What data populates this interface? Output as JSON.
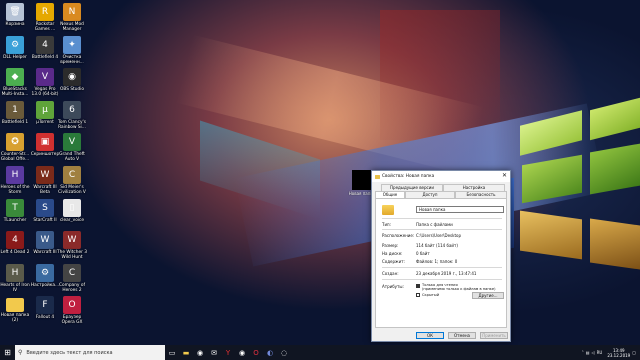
{
  "desktop_icons": [
    {
      "label": "Корзина",
      "icon": "recycle-bin-icon",
      "color": "#b6c3d6",
      "glyph": "🗑"
    },
    {
      "label": "Rockstar Games ...",
      "icon": "rockstar-icon",
      "color": "#e5a800",
      "glyph": "R"
    },
    {
      "label": "Nexus Mod Manager",
      "icon": "nexus-icon",
      "color": "#d98a20",
      "glyph": "N"
    },
    {
      "label": "DLL Helper",
      "icon": "dll-helper-icon",
      "color": "#3aa0d8",
      "glyph": "⚙"
    },
    {
      "label": "Battlefield 4",
      "icon": "battlefield-icon",
      "color": "#3a3a3a",
      "glyph": "4"
    },
    {
      "label": "Очистка временн...",
      "icon": "cleanup-icon",
      "color": "#5a8fcf",
      "glyph": "✦"
    },
    {
      "label": "BlueStacks Multi-Insta...",
      "icon": "bluestacks-icon",
      "color": "#4caf50",
      "glyph": "◆"
    },
    {
      "label": "Vegas Pro 13.0 (64-bit)",
      "icon": "vegas-icon",
      "color": "#5a2a8a",
      "glyph": "V"
    },
    {
      "label": "OBS Studio",
      "icon": "obs-icon",
      "color": "#2b2b2b",
      "glyph": "◉"
    },
    {
      "label": "Battlefield 1",
      "icon": "battlefield1-icon",
      "color": "#6a5a3a",
      "glyph": "1"
    },
    {
      "label": "µTorrent",
      "icon": "utorrent-icon",
      "color": "#5fa43a",
      "glyph": "µ"
    },
    {
      "label": "Tom Clancy's Rainbow Si...",
      "icon": "rainbow-six-icon",
      "color": "#3d4a5a",
      "glyph": "6"
    },
    {
      "label": "Counter-Str... Global Offe...",
      "icon": "csgo-icon",
      "color": "#d8a030",
      "glyph": "✪"
    },
    {
      "label": "Скриншотер",
      "icon": "screenshoter-icon",
      "color": "#d03030",
      "glyph": "▣"
    },
    {
      "label": "Grand Theft Auto V",
      "icon": "gta5-icon",
      "color": "#2a7a3a",
      "glyph": "V"
    },
    {
      "label": "Heroes of the Storm",
      "icon": "hots-icon",
      "color": "#5a3aa0",
      "glyph": "H"
    },
    {
      "label": "Warcraft III Beta",
      "icon": "warcraft3-beta-icon",
      "color": "#7a2a1a",
      "glyph": "W"
    },
    {
      "label": "Sid Meier's Civilization V",
      "icon": "civ5-icon",
      "color": "#a08040",
      "glyph": "C"
    },
    {
      "label": "TLauncher",
      "icon": "tlauncher-icon",
      "color": "#3a8a3a",
      "glyph": "T"
    },
    {
      "label": "StarCraft II",
      "icon": "starcraft2-icon",
      "color": "#2a4a8a",
      "glyph": "S"
    },
    {
      "label": "clear_voice",
      "icon": "file-icon",
      "color": "#e8e8e8",
      "glyph": "▯"
    },
    {
      "label": "Left 4 Dead 2",
      "icon": "l4d2-icon",
      "color": "#8a1a1a",
      "glyph": "4"
    },
    {
      "label": "Warcraft III",
      "icon": "warcraft3-icon",
      "color": "#3a5a8a",
      "glyph": "W"
    },
    {
      "label": "The Witcher 3 Wild Hunt",
      "icon": "witcher3-icon",
      "color": "#8a2a2a",
      "glyph": "W"
    },
    {
      "label": "Hearts of Iron IV",
      "icon": "hoi4-icon",
      "color": "#5a5a4a",
      "glyph": "H"
    },
    {
      "label": "Настройка...",
      "icon": "settings-shortcut-icon",
      "color": "#3a6aa0",
      "glyph": "⚙"
    },
    {
      "label": "Company of Heroes 2",
      "icon": "coh2-icon",
      "color": "#444444",
      "glyph": "C"
    },
    {
      "label": "Новая папка (2)",
      "icon": "folder-icon",
      "color": "#f2c94c",
      "glyph": ""
    },
    {
      "label": "Fallout 4",
      "icon": "fallout4-icon",
      "color": "#1a2a4a",
      "glyph": "F"
    },
    {
      "label": "Браузер Opera GX",
      "icon": "opera-gx-icon",
      "color": "#c02040",
      "glyph": "O"
    }
  ],
  "selected_folder_label": "Новая папка",
  "dialog": {
    "title": "Свойства: Новая папка",
    "close_glyph": "✕",
    "tabs_top": [
      "Предыдущие версии",
      "Настройка"
    ],
    "tabs_bottom": [
      "Общие",
      "Доступ",
      "Безопасность"
    ],
    "active_tab": "Общие",
    "name_value": "Новая папка",
    "properties": [
      {
        "key": "Тип:",
        "value": "Папка с файлами"
      },
      {
        "key": "Расположение:",
        "value": "C:\\Users\\User\\Desktop"
      },
      {
        "key": "Размер:",
        "value": "114 байт (114 байт)"
      },
      {
        "key": "На диске:",
        "value": "0 байт"
      },
      {
        "key": "Содержит:",
        "value": "Файлов: 1; папок: 0"
      },
      {
        "key": "Создан:",
        "value": "23 декабря 2019 г., 13:47:41"
      }
    ],
    "attributes_label": "Атрибуты:",
    "attr_readonly": "Только для чтения",
    "attr_readonly_note": "(применимо только к файлам в папке)",
    "attr_hidden": "Скрытый",
    "other_button": "Другие...",
    "ok": "ОК",
    "cancel": "Отмена",
    "apply": "Применить"
  },
  "taskbar": {
    "search_placeholder": "Введите здесь текст для поиска",
    "icons": [
      "task-view-icon",
      "file-explorer-icon",
      "steam-icon",
      "mail-icon",
      "yandex-browser-icon",
      "steam-icon-2",
      "opera-icon",
      "discord-icon",
      "media-icon"
    ],
    "tray_lang": "RU",
    "time": "13:49",
    "date": "23.12.2019"
  },
  "colors": {
    "accent": "#0078d7",
    "taskbar": "#101522",
    "dialog_bg": "#f0f0f0"
  }
}
